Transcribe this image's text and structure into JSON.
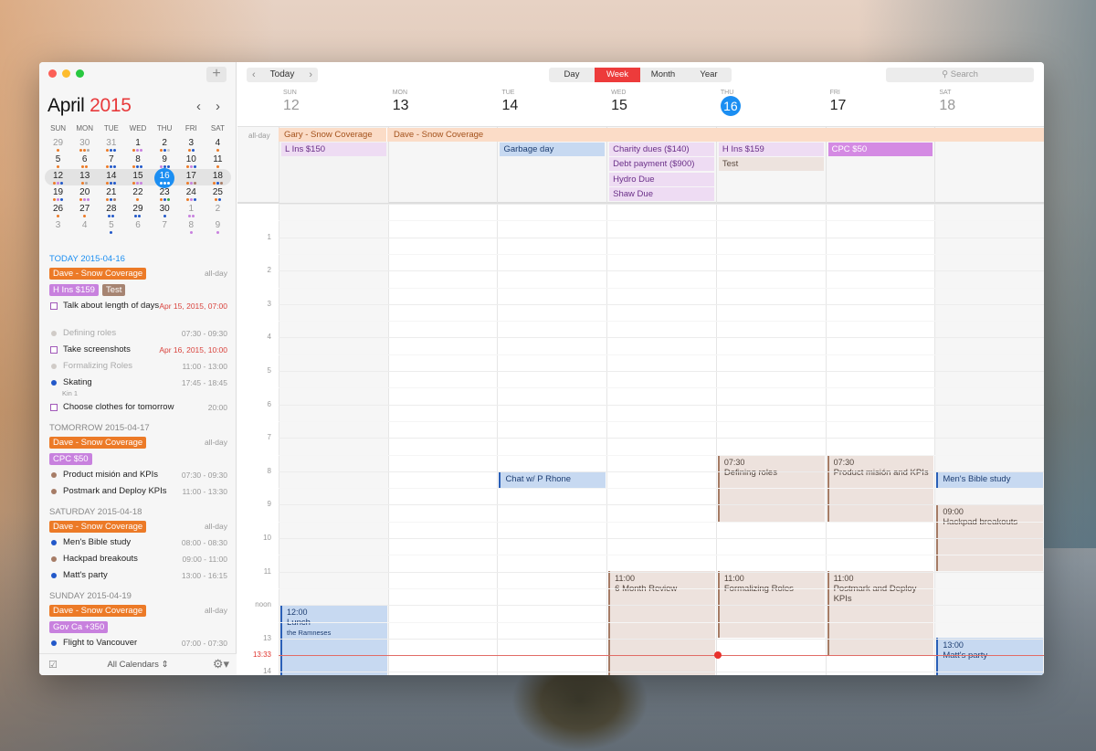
{
  "colors": {
    "accent_red": "#ed3b3b",
    "today_blue": "#1b8ef2",
    "orange": "#ec7a27",
    "purple": "#c881de",
    "brown": "#a68472",
    "blue": "#2258c9",
    "grey": "#d0cbc7"
  },
  "sidebar": {
    "add_label": "+",
    "month": "April",
    "year": "2015",
    "prev_icon": "‹",
    "next_icon": "›",
    "weekdays": [
      "SUN",
      "MON",
      "TUE",
      "WED",
      "THU",
      "FRI",
      "SAT"
    ],
    "weeks": [
      [
        {
          "d": "29",
          "dim": true,
          "dots": [
            "o"
          ]
        },
        {
          "d": "30",
          "dim": true,
          "dots": [
            "o",
            "o",
            "c"
          ]
        },
        {
          "d": "31",
          "dim": true,
          "dots": [
            "o",
            "b",
            "b"
          ]
        },
        {
          "d": "1",
          "dots": [
            "o",
            "p",
            "p"
          ]
        },
        {
          "d": "2",
          "dots": [
            "o",
            "b",
            "g"
          ]
        },
        {
          "d": "3",
          "dots": [
            "o",
            "b"
          ]
        },
        {
          "d": "4",
          "dots": [
            "o"
          ]
        }
      ],
      [
        {
          "d": "5",
          "dots": [
            "o"
          ]
        },
        {
          "d": "6",
          "dots": [
            "o",
            "o"
          ]
        },
        {
          "d": "7",
          "dots": [
            "o",
            "b",
            "b"
          ]
        },
        {
          "d": "8",
          "dots": [
            "o",
            "b",
            "b"
          ]
        },
        {
          "d": "9",
          "dots": [
            "p",
            "b",
            "b"
          ]
        },
        {
          "d": "10",
          "dots": [
            "o",
            "p",
            "b"
          ]
        },
        {
          "d": "11",
          "dots": [
            "o"
          ]
        }
      ],
      [
        {
          "d": "12",
          "dots": [
            "o",
            "p",
            "b"
          ]
        },
        {
          "d": "13",
          "dots": [
            "o",
            "c"
          ]
        },
        {
          "d": "14",
          "dots": [
            "o",
            "b",
            "b"
          ]
        },
        {
          "d": "15",
          "dots": [
            "o",
            "p",
            "p"
          ]
        },
        {
          "d": "16",
          "today": true,
          "dots": [
            "w",
            "w",
            "w"
          ]
        },
        {
          "d": "17",
          "dots": [
            "o",
            "p",
            "r"
          ]
        },
        {
          "d": "18",
          "dots": [
            "o",
            "b",
            "r"
          ]
        }
      ],
      [
        {
          "d": "19",
          "dots": [
            "o",
            "p",
            "b"
          ]
        },
        {
          "d": "20",
          "dots": [
            "o",
            "p",
            "p"
          ]
        },
        {
          "d": "21",
          "dots": [
            "o",
            "b",
            "r"
          ]
        },
        {
          "d": "22",
          "dots": [
            "o"
          ]
        },
        {
          "d": "23",
          "dots": [
            "o",
            "b",
            "gr"
          ]
        },
        {
          "d": "24",
          "dots": [
            "o",
            "p",
            "b"
          ]
        },
        {
          "d": "25",
          "dots": [
            "o",
            "b"
          ]
        }
      ],
      [
        {
          "d": "26",
          "dots": [
            "o"
          ]
        },
        {
          "d": "27",
          "dots": [
            "o"
          ]
        },
        {
          "d": "28",
          "dots": [
            "b",
            "b"
          ]
        },
        {
          "d": "29",
          "dots": [
            "b",
            "b"
          ]
        },
        {
          "d": "30",
          "dots": [
            "b"
          ]
        },
        {
          "d": "1",
          "dim": true,
          "dots": [
            "p",
            "p"
          ]
        },
        {
          "d": "2",
          "dim": true,
          "dots": []
        }
      ],
      [
        {
          "d": "3",
          "dim": true,
          "dots": []
        },
        {
          "d": "4",
          "dim": true,
          "dots": []
        },
        {
          "d": "5",
          "dim": true,
          "dots": [
            "b"
          ]
        },
        {
          "d": "6",
          "dim": true,
          "dots": []
        },
        {
          "d": "7",
          "dim": true,
          "dots": []
        },
        {
          "d": "8",
          "dim": true,
          "dots": [
            "p"
          ]
        },
        {
          "d": "9",
          "dim": true,
          "dots": [
            "p"
          ]
        }
      ]
    ],
    "agenda": {
      "today": {
        "heading": "TODAY 2015-04-16",
        "allday_label": "all-day",
        "pill1": "Dave - Snow Coverage",
        "pill2": "H Ins $159",
        "pill3": "Test",
        "items": [
          {
            "type": "task",
            "text": "Talk about length of days",
            "time": "Apr 15, 2015, 07:00",
            "overdue": true
          },
          {
            "type": "event",
            "text": "Defining roles",
            "time": "07:30 - 09:30",
            "faded": true
          },
          {
            "type": "task",
            "text": "Take screenshots",
            "time": "Apr 16, 2015, 10:00",
            "overdue": true
          },
          {
            "type": "event",
            "text": "Formalizing Roles",
            "time": "11:00 - 13:00",
            "faded": true
          },
          {
            "type": "event",
            "text": "Skating",
            "time": "17:45 - 18:45",
            "sub": "Kin 1"
          },
          {
            "type": "task",
            "text": "Choose clothes for tomorrow",
            "time": "20:00"
          }
        ]
      },
      "tomorrow": {
        "heading": "TOMORROW 2015-04-17",
        "allday_label": "all-day",
        "pill1": "Dave - Snow Coverage",
        "pill2": "CPC $50",
        "items": [
          {
            "text": "Product misión and KPIs",
            "time": "07:30 - 09:30"
          },
          {
            "text": "Postmark and Deploy KPIs",
            "time": "11:00 - 13:30"
          }
        ]
      },
      "saturday": {
        "heading": "SATURDAY 2015-04-18",
        "allday_label": "all-day",
        "pill1": "Dave - Snow Coverage",
        "items": [
          {
            "text": "Men's Bible study",
            "time": "08:00 - 08:30"
          },
          {
            "text": "Hackpad breakouts",
            "time": "09:00 - 11:00"
          },
          {
            "text": "Matt's party",
            "time": "13:00 - 16:15"
          }
        ]
      },
      "sunday": {
        "heading": "SUNDAY 2015-04-19",
        "allday_label": "all-day",
        "pill1": "Dave - Snow Coverage",
        "pill2": "Gov Ca +350",
        "items": [
          {
            "text": "Flight to Vancouver",
            "time": "07:00 - 07:30"
          }
        ]
      }
    },
    "footer": {
      "checkbox_icon": "☑",
      "calendars_label": "All Calendars ⇕",
      "gear_icon": "⚙▾"
    }
  },
  "toolbar": {
    "prev": "‹",
    "today": "Today",
    "next": "›",
    "views": [
      "Day",
      "Week",
      "Month",
      "Year"
    ],
    "active_view": "Week",
    "search_placeholder": "Search",
    "search_icon": "⚲"
  },
  "week": {
    "days": [
      {
        "wd": "SUN",
        "dn": "12"
      },
      {
        "wd": "MON",
        "dn": "13"
      },
      {
        "wd": "TUE",
        "dn": "14"
      },
      {
        "wd": "WED",
        "dn": "15"
      },
      {
        "wd": "THU",
        "dn": "16"
      },
      {
        "wd": "FRI",
        "dn": "17"
      },
      {
        "wd": "SAT",
        "dn": "18"
      }
    ],
    "allday_label": "all-day",
    "banners": [
      "Gary - Snow Coverage",
      "Dave - Snow Coverage"
    ],
    "allday_events": {
      "sun": [
        "L Ins $150"
      ],
      "tue": [
        "Garbage day"
      ],
      "wed": [
        "Charity dues ($140)",
        "Debt payment ($900)",
        "Hydro Due",
        "Shaw Due"
      ],
      "thu": [
        "H Ins $159",
        "Test"
      ],
      "fri": [
        "CPC $50"
      ]
    },
    "hours": [
      "1",
      "2",
      "3",
      "4",
      "5",
      "6",
      "7",
      "8",
      "9",
      "10",
      "11",
      "noon",
      "13",
      "14"
    ],
    "now_label": "13:33",
    "events": {
      "sun_lunch": {
        "time": "12:00",
        "title": "Lunch",
        "sub": "the Ramneses"
      },
      "tue_chat": {
        "title": "Chat w/ P Rhone"
      },
      "wed_review": {
        "time": "11:00",
        "title": "6 Month Review"
      },
      "thu_defining": {
        "time": "07:30",
        "title": "Defining roles"
      },
      "thu_formalizing": {
        "time": "11:00",
        "title": "Formalizing Roles"
      },
      "fri_product": {
        "time": "07:30",
        "title": "Product misión and KPIs"
      },
      "fri_postmark": {
        "time": "11:00",
        "title": "Postmark and Deploy KPIs"
      },
      "sat_bible": {
        "title": "Men's Bible study"
      },
      "sat_hackpad": {
        "time": "09:00",
        "title": "Hackpad breakouts"
      },
      "sat_party": {
        "time": "13:00",
        "title": "Matt's party"
      }
    }
  }
}
